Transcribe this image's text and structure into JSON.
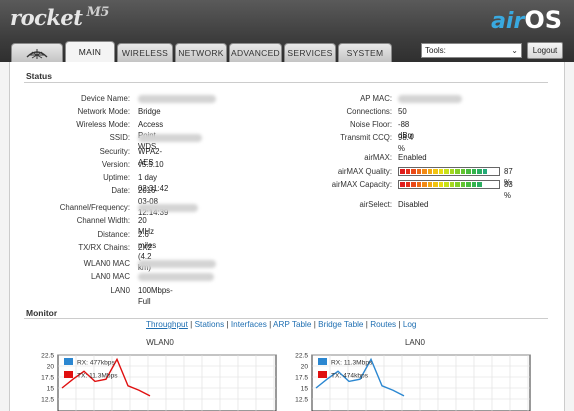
{
  "header": {
    "brand": "rocket",
    "model": "M5",
    "product_logo": {
      "air": "air",
      "os": "OS"
    }
  },
  "tabs": [
    {
      "label": "MAIN",
      "active": true
    },
    {
      "label": "WIRELESS"
    },
    {
      "label": "NETWORK"
    },
    {
      "label": "ADVANCED"
    },
    {
      "label": "SERVICES"
    },
    {
      "label": "SYSTEM"
    }
  ],
  "tools": {
    "value": "Tools:"
  },
  "logout_label": "Logout",
  "status": {
    "title": "Status",
    "left": [
      {
        "label": "Device Name:",
        "value": ""
      },
      {
        "label": "Network Mode:",
        "value": "Bridge"
      },
      {
        "label": "Wireless Mode:",
        "value": "Access Point WDS"
      },
      {
        "label": "SSID:",
        "value": ""
      },
      {
        "label": "Security:",
        "value": "WPA2-AES"
      },
      {
        "label": "Version:",
        "value": "v5.5.10"
      },
      {
        "label": "Uptime:",
        "value": "1 day 02:31:42"
      },
      {
        "label": "Date:",
        "value": "2016-03-08 12:14:39"
      },
      {
        "label": "Channel/Frequency:",
        "value": ""
      },
      {
        "label": "Channel Width:",
        "value": "20 MHz"
      },
      {
        "label": "Distance:",
        "value": "2.6 miles (4.2 km)"
      },
      {
        "label": "TX/RX Chains:",
        "value": "2X2"
      },
      {
        "label": "WLAN0 MAC",
        "value": ""
      },
      {
        "label": "LAN0 MAC",
        "value": ""
      },
      {
        "label": "LAN0",
        "value": "100Mbps-Full"
      }
    ],
    "right": [
      {
        "label": "AP MAC:",
        "value": ""
      },
      {
        "label": "Connections:",
        "value": "50"
      },
      {
        "label": "Noise Floor:",
        "value": "-88 dBm"
      },
      {
        "label": "Transmit CCQ:",
        "value": "98.4 %"
      },
      {
        "label": "airMAX:",
        "value": "Enabled"
      },
      {
        "label": "airMAX Quality:",
        "value": "87 %",
        "level": 0.87
      },
      {
        "label": "airMAX Capacity:",
        "value": "83 %",
        "level": 0.83
      },
      {
        "label": "airSelect:",
        "value": "Disabled"
      }
    ]
  },
  "monitor": {
    "title": "Monitor",
    "links": [
      "Throughput",
      "Stations",
      "Interfaces",
      "ARP Table",
      "Bridge Table",
      "Routes",
      "Log"
    ],
    "separator": " | "
  },
  "colors": {
    "rx": "#2b87d1",
    "tx": "#e01010",
    "accent": "#39a9e0"
  },
  "chart_data": [
    {
      "type": "line",
      "title": "WLAN0",
      "yticks": [
        "22.5",
        "20",
        "17.5",
        "15",
        "12.5"
      ],
      "ylim": [
        12.5,
        22.5
      ],
      "legend": [
        "RX: 477kbps",
        "TX: 11.3Mbps"
      ],
      "series": [
        {
          "name": "RX: 477kbps",
          "values": []
        },
        {
          "name": "TX: 11.3Mbps",
          "values": [
            15,
            17,
            18.8,
            16.5,
            17,
            21.5,
            15.5,
            14.5,
            13.2
          ]
        }
      ]
    },
    {
      "type": "line",
      "title": "LAN0",
      "yticks": [
        "22.5",
        "20",
        "17.5",
        "15",
        "12.5"
      ],
      "ylim": [
        12.5,
        22.5
      ],
      "legend": [
        "RX: 11.3Mbps",
        "TX: 474kbps"
      ],
      "series": [
        {
          "name": "RX: 11.3Mbps",
          "values": [
            15,
            17,
            18.8,
            16.5,
            17,
            21.5,
            15.5,
            14.5,
            13.2
          ]
        },
        {
          "name": "TX: 474kbps",
          "values": []
        }
      ]
    }
  ]
}
